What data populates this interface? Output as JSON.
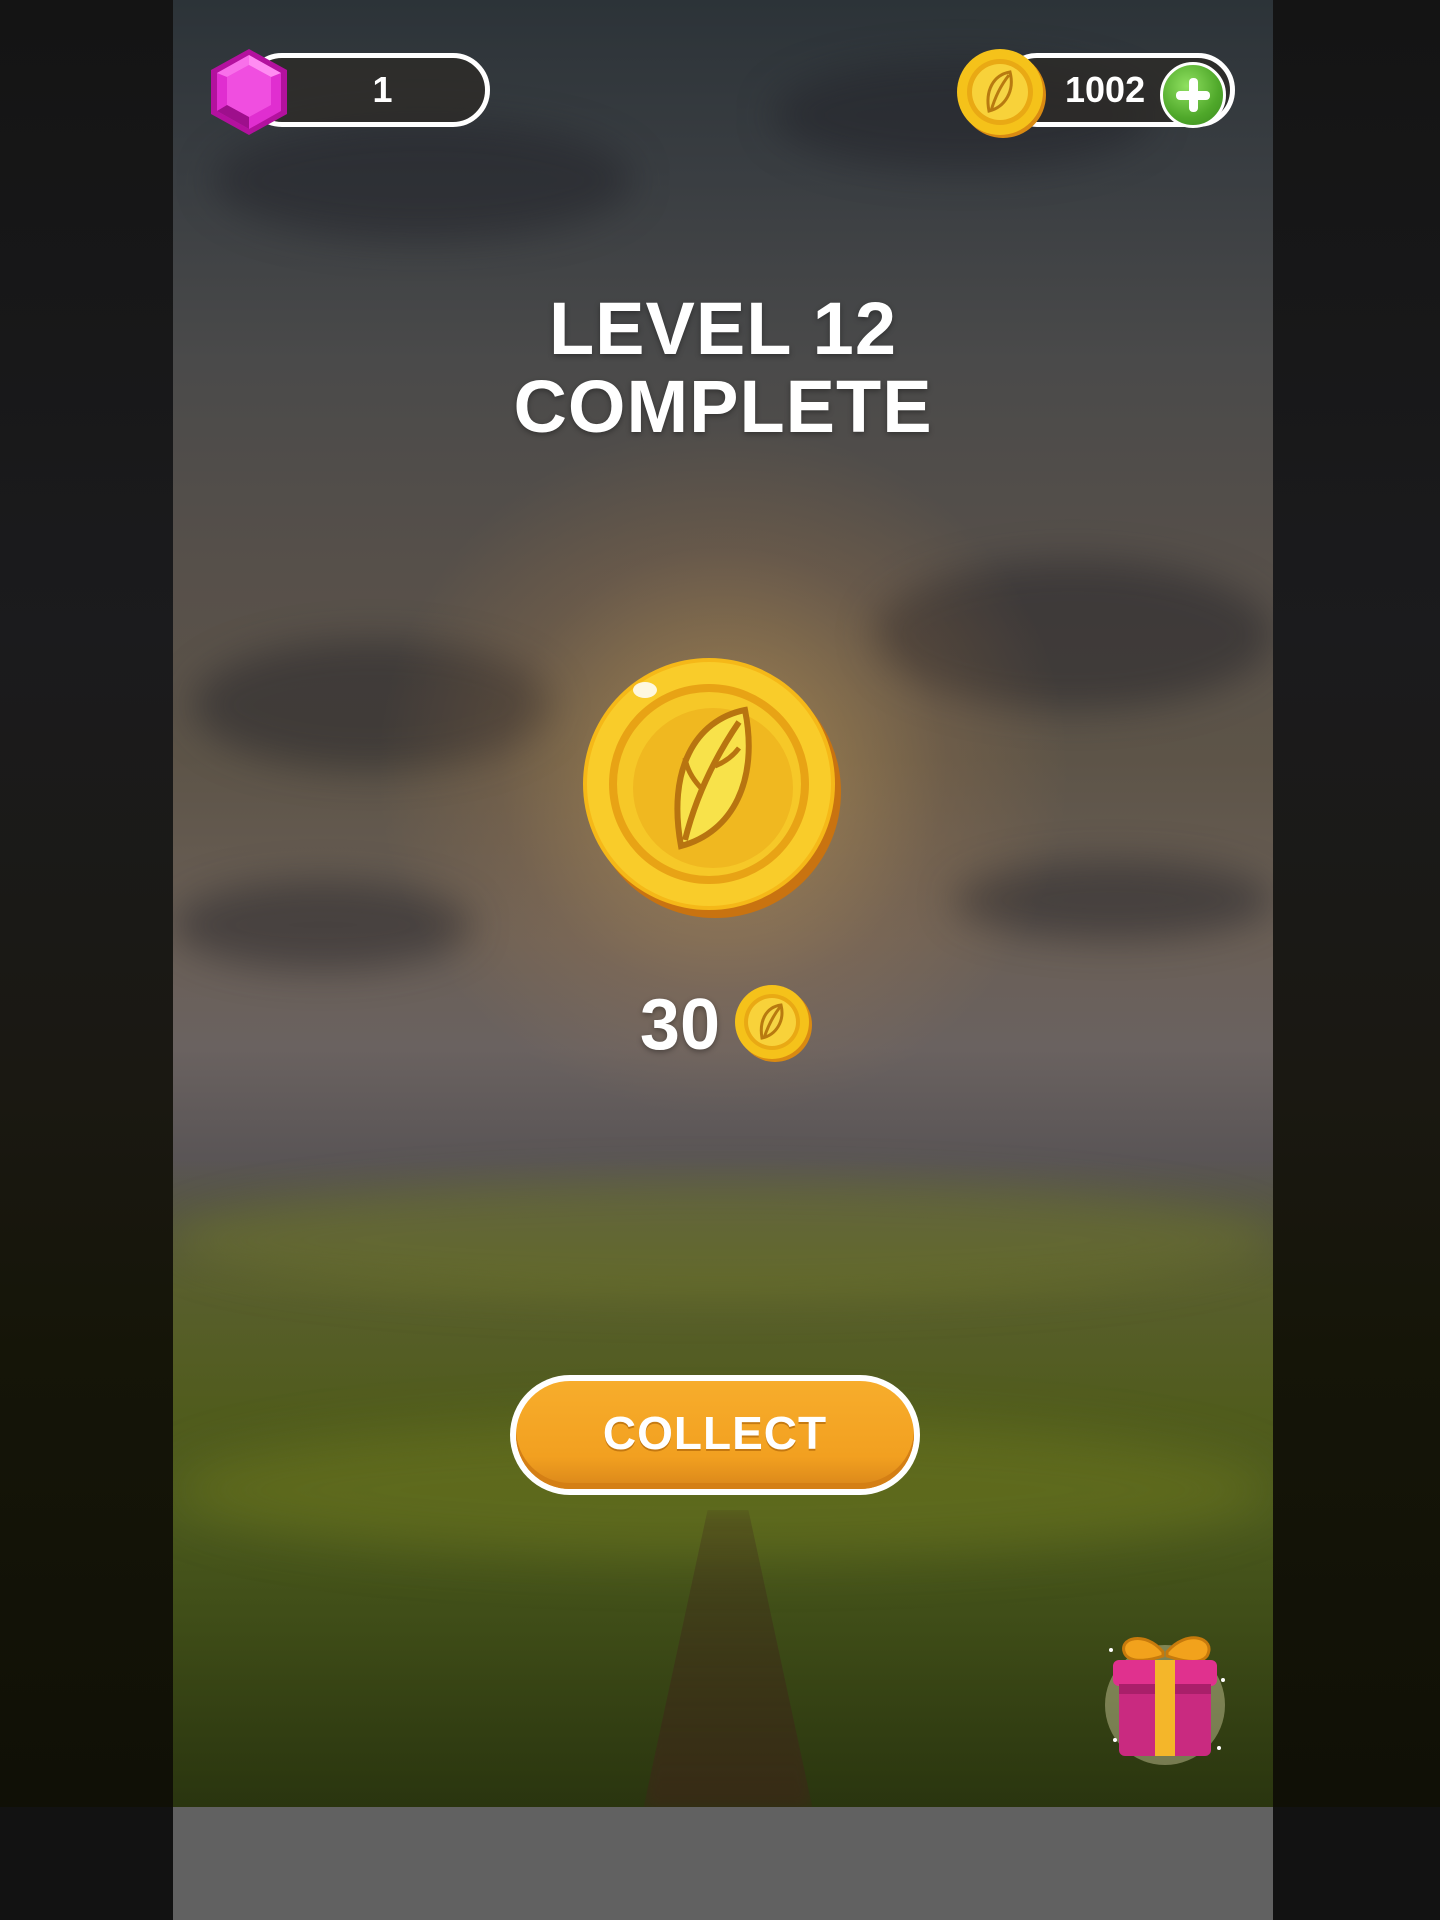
{
  "hud": {
    "gems": "1",
    "coins": "1002"
  },
  "title": {
    "line1": "LEVEL 12",
    "line2": "COMPLETE"
  },
  "reward": {
    "amount": "30"
  },
  "collect_button": {
    "label": "COLLECT"
  },
  "icons": {
    "gem": "gem-icon",
    "hud_coin": "coin-icon",
    "plus": "plus-icon",
    "big_coin": "coin-icon",
    "reward_coin": "coin-icon",
    "gift": "gift-icon"
  },
  "colors": {
    "accent_orange": "#f2a020",
    "gem_magenta": "#e02ed0",
    "coin_gold": "#f5c21a",
    "plus_green": "#4fa82a",
    "bottom_bar": "#616161"
  }
}
